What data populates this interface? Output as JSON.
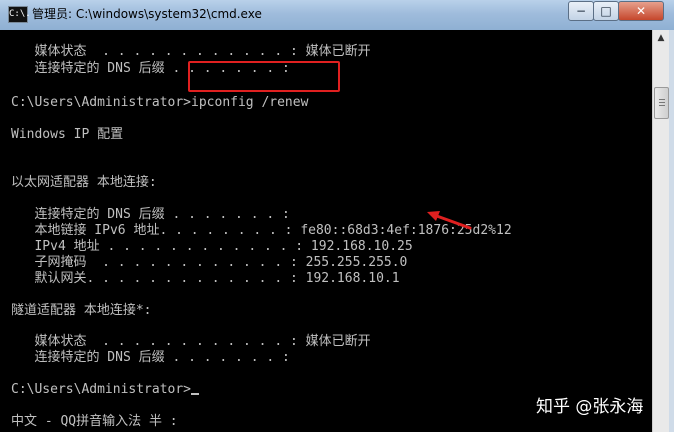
{
  "window": {
    "icon_text": "C:\\.",
    "title": "管理员: C:\\windows\\system32\\cmd.exe",
    "minimize_glyph": "−",
    "maximize_glyph": "□",
    "close_glyph": "✕"
  },
  "console": {
    "lines": [
      "   媒体状态  . . . . . . . . . . . . : 媒体已断开",
      "   连接特定的 DNS 后缀 . . . . . . . :",
      "C:\\Users\\Administrator>ipconfig /renew",
      "Windows IP 配置",
      "以太网适配器 本地连接:",
      "   连接特定的 DNS 后缀 . . . . . . . :",
      "   本地链接 IPv6 地址. . . . . . . . : fe80::68d3:4ef:1876:25d2%12",
      "   IPv4 地址 . . . . . . . . . . . . : 192.168.10.25",
      "   子网掩码  . . . . . . . . . . . . : 255.255.255.0",
      "   默认网关. . . . . . . . . . . . . : 192.168.10.1",
      "隧道适配器 本地连接*:",
      "   媒体状态  . . . . . . . . . . . . : 媒体已断开",
      "   连接特定的 DNS 后缀 . . . . . . . :",
      "C:\\Users\\Administrator>",
      "中文 - QQ拼音输入法 半 :"
    ]
  },
  "scrollbar": {
    "up_glyph": "▲"
  },
  "watermark": "知乎 @张永海",
  "colors": {
    "console_bg": "#000000",
    "console_text": "#c0c0c0",
    "annotation_red": "#e02020"
  }
}
